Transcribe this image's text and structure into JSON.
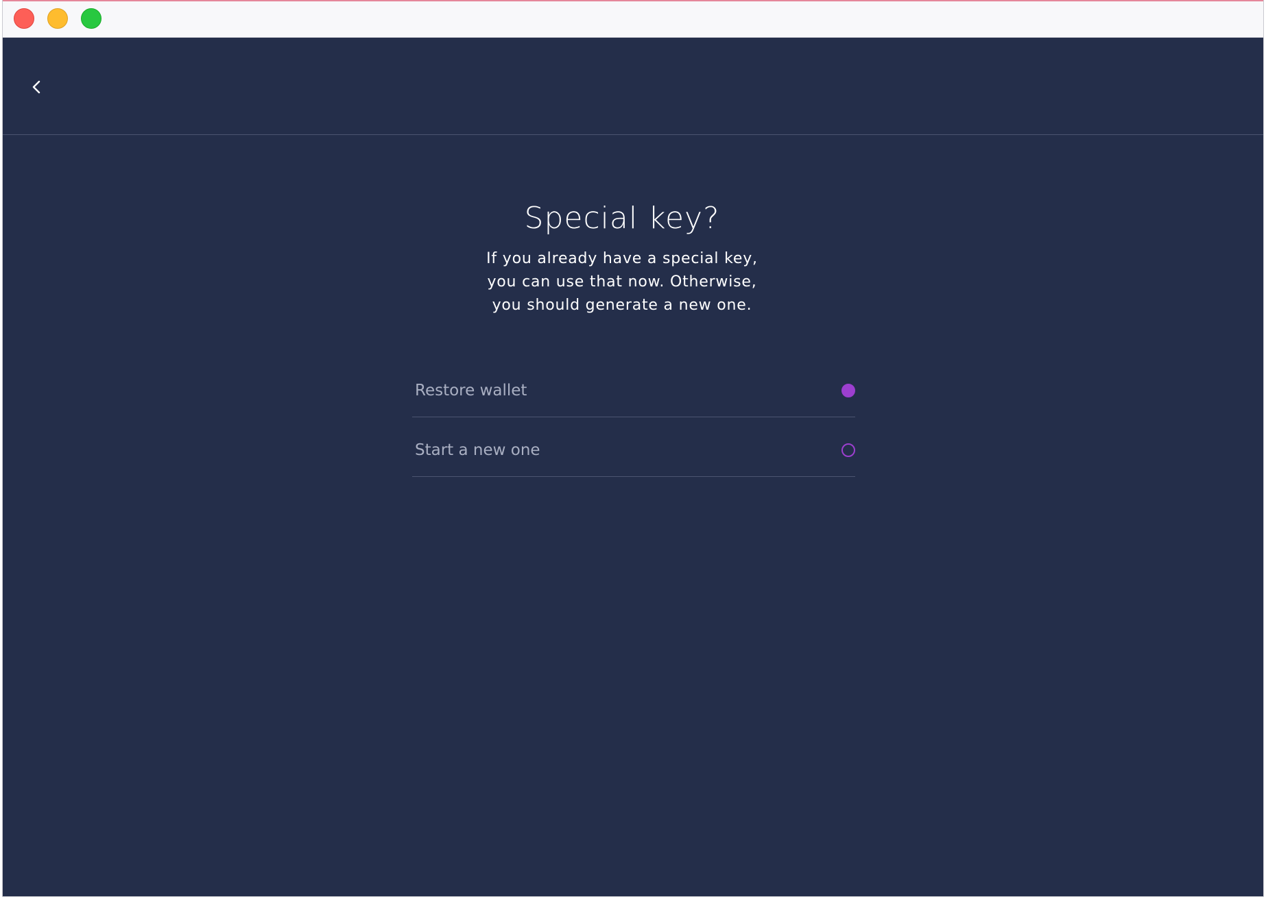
{
  "header": {
    "back_icon": "chevron-left-icon"
  },
  "main": {
    "title": "Special key?",
    "subtitle": "If you already have a special key,\nyou can use that now. Otherwise,\nyou should generate a new one.",
    "options": [
      {
        "label": "Restore wallet",
        "selected": true
      },
      {
        "label": "Start a new one",
        "selected": false
      }
    ]
  },
  "colors": {
    "background": "#242e4a",
    "accent": "#9c3fcf",
    "option_text": "#a9afc2",
    "divider": "#4c5571"
  }
}
